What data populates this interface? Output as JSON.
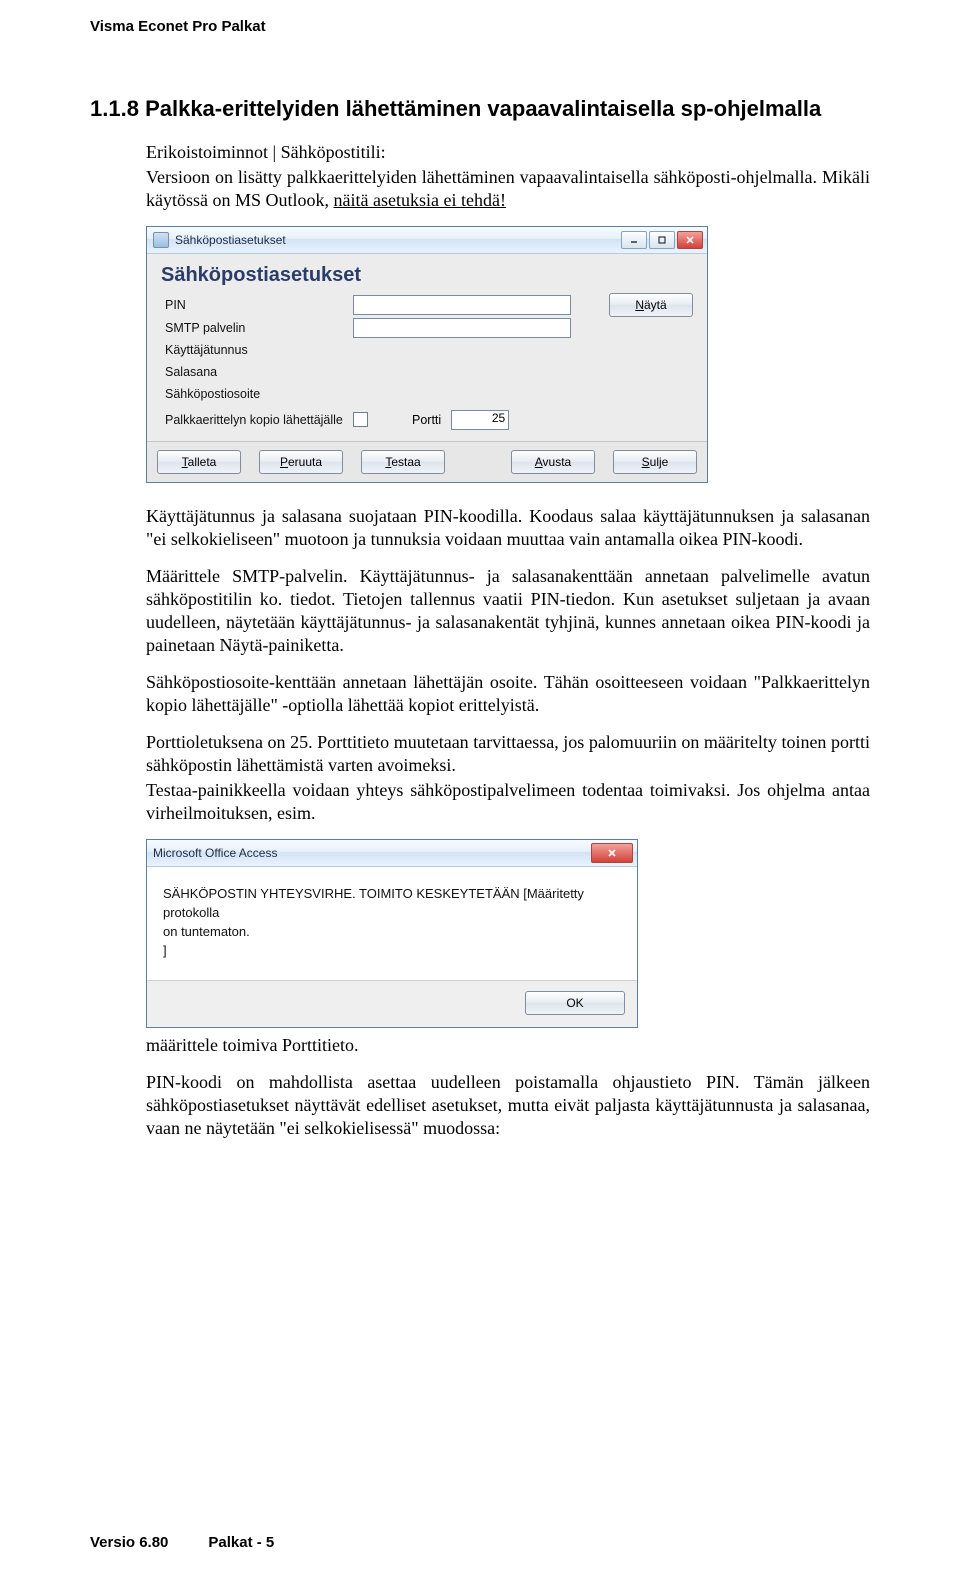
{
  "header": {
    "product": "Visma Econet Pro Palkat"
  },
  "section": {
    "number": "1.1.8",
    "title": "Palkka-erittelyiden lähettäminen vapaavalintaisella sp-ohjelmalla"
  },
  "intro": {
    "breadcrumb": "Erikoistoiminnot | Sähköpostitili:",
    "p1a": "Versioon on lisätty palkkaerittelyiden lähettäminen vapaavalintaisella sähköposti-ohjelmalla. Mikäli käytössä on MS Outlook, ",
    "p1b_underlined": "näitä asetuksia ei tehdä!"
  },
  "settings_dialog": {
    "window_title": "Sähköpostiasetukset",
    "heading": "Sähköpostiasetukset",
    "labels": {
      "pin": "PIN",
      "smtp": "SMTP palvelin",
      "user": "Käyttäjätunnus",
      "password": "Salasana",
      "email": "Sähköpostiosoite",
      "copy_to_sender": "Palkkaerittelyn kopio lähettäjälle",
      "port": "Portti"
    },
    "values": {
      "pin": "",
      "smtp": "",
      "user": "",
      "password": "",
      "email": "",
      "copy_to_sender": false,
      "port": "25"
    },
    "buttons": {
      "show": "Näytä",
      "save": "Talleta",
      "cancel": "Peruuta",
      "test": "Testaa",
      "help": "Avusta",
      "close": "Sulje"
    },
    "button_hotkeys": {
      "show": "N",
      "save": "T",
      "cancel": "P",
      "test": "T",
      "help": "A",
      "close": "S"
    }
  },
  "para": {
    "p2": "Käyttäjätunnus ja salasana suojataan PIN-koodilla. Koodaus salaa käyttäjätunnuksen ja salasanan \"ei selkokieliseen\" muotoon ja tunnuksia voidaan muuttaa vain antamalla oikea PIN-koodi.",
    "p3": "Määrittele SMTP-palvelin. Käyttäjätunnus- ja salasanakenttään annetaan palvelimelle avatun sähköpostitilin ko. tiedot. Tietojen tallennus vaatii PIN-tiedon. Kun asetukset suljetaan ja avaan uudelleen, näytetään käyttäjätunnus- ja salasanakentät tyhjinä, kunnes annetaan oikea PIN-koodi ja painetaan Näytä-painiketta.",
    "p4": "Sähköpostiosoite-kenttään annetaan lähettäjän osoite. Tähän osoitteeseen voidaan \"Palkkaerittelyn kopio lähettäjälle\" -optiolla lähettää kopiot erittelyistä.",
    "p5": "Porttioletuksena on 25. Porttitieto muutetaan tarvittaessa, jos palomuuriin on määritelty toinen portti sähköpostin lähettämistä varten avoimeksi.",
    "p6": "Testaa-painikkeella voidaan yhteys sähköpostipalvelimeen todentaa toimivaksi. Jos ohjelma antaa virheilmoituksen, esim."
  },
  "error_dialog": {
    "window_title": "Microsoft Office Access",
    "line1": "SÄHKÖPOSTIN YHTEYSVIRHE. TOIMITO KESKEYTETÄÄN [Määritetty protokolla",
    "line2": "on tuntematon.",
    "line3": "]",
    "ok": "OK"
  },
  "para2": {
    "p7": "määrittele toimiva Porttitieto.",
    "p8": "PIN-koodi on mahdollista asettaa uudelleen poistamalla ohjaustieto PIN. Tämän jälkeen sähköpostiasetukset näyttävät edelliset asetukset, mutta eivät paljasta käyttäjätunnusta ja salasanaa, vaan ne näytetään \"ei selkokielisessä\" muodossa:"
  },
  "footer": {
    "version": "Versio 6.80",
    "page": "Palkat - 5"
  }
}
